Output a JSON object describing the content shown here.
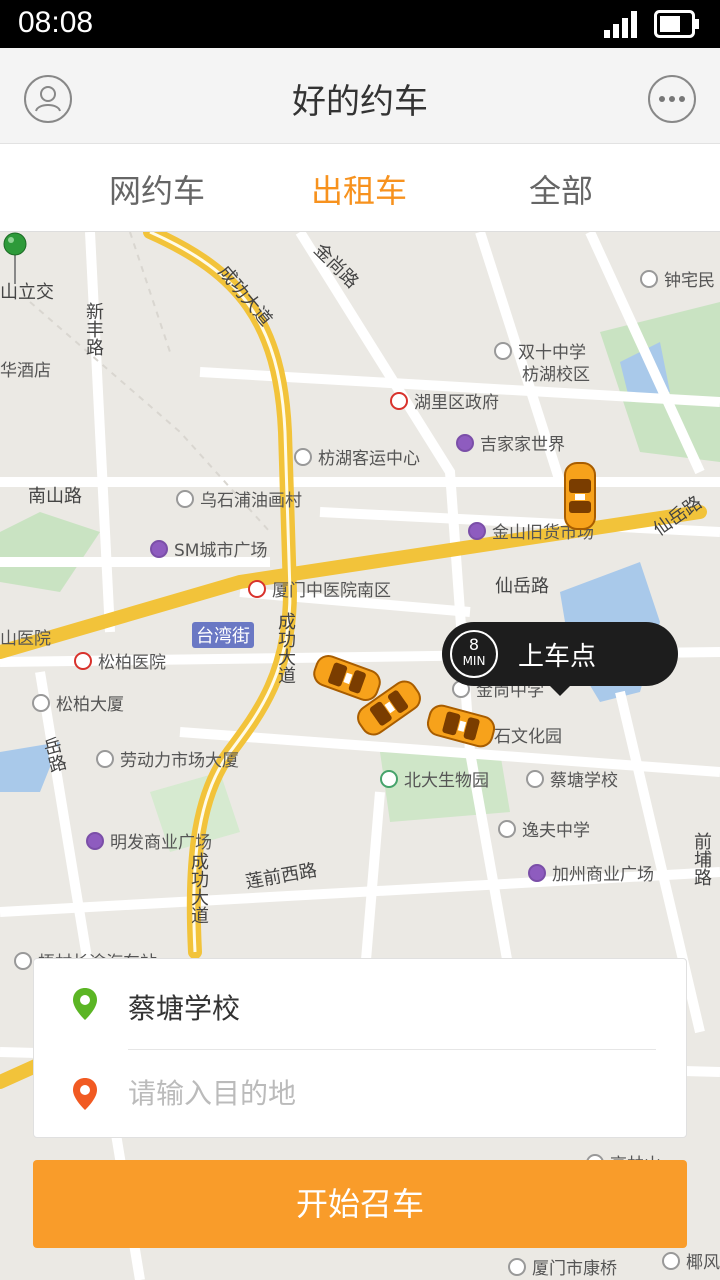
{
  "status_bar": {
    "time": "08:08"
  },
  "header": {
    "title": "好的约车",
    "avatar_icon": "user-icon",
    "more_icon": "more-dots-icon"
  },
  "tabs": [
    {
      "label": "网约车",
      "active": false
    },
    {
      "label": "出租车",
      "active": true
    },
    {
      "label": "全部",
      "active": false
    }
  ],
  "map": {
    "roads": {
      "r1": "金尚路",
      "r2": "新丰路",
      "r3": "成功大道",
      "r4": "南山路",
      "r5": "仙岳路",
      "r6": "仙岳路",
      "r7": "台湾街",
      "r8": "成功大道",
      "r9": "莲前西路",
      "r10": "岳路",
      "r11": "成功大道",
      "r12": "前埔路",
      "r13": "山立交"
    },
    "pois": {
      "p1": "钟宅民",
      "p2": "双十中学",
      "p3": "枋湖校区",
      "p4": "湖里区政府",
      "p5": "华酒店",
      "p6": "吉家家世界",
      "p7": "枋湖客运中心",
      "p8": "乌石浦油画村",
      "p9": "金山旧货市场",
      "p10": "SM城市广场",
      "p11": "厦门中医院南区",
      "p12": "山医院",
      "p13": "松柏医院",
      "p14": "松柏大厦",
      "p15": "劳动力市场大厦",
      "p16": "北大生物园",
      "p17": "蔡塘学校",
      "p18": "逸夫中学",
      "p19": "明发商业广场",
      "p20": "加州商业广场",
      "p21": "梧村长途汽车站",
      "p22": "高林山",
      "p23": "厦门市康桥",
      "p24": "椰风",
      "p25": "金尚中学",
      "p26": "石文化园"
    },
    "pickup": {
      "eta_number": "8",
      "eta_unit": "MIN",
      "label": "上车点"
    }
  },
  "address_card": {
    "origin": "蔡塘学校",
    "destination_placeholder": "请输入目的地",
    "destination_value": ""
  },
  "call_button": {
    "label": "开始召车"
  },
  "colors": {
    "accent": "#f7921e",
    "button": "#f99c2a",
    "origin_pin": "#5bb524",
    "dest_pin": "#f15a22"
  }
}
